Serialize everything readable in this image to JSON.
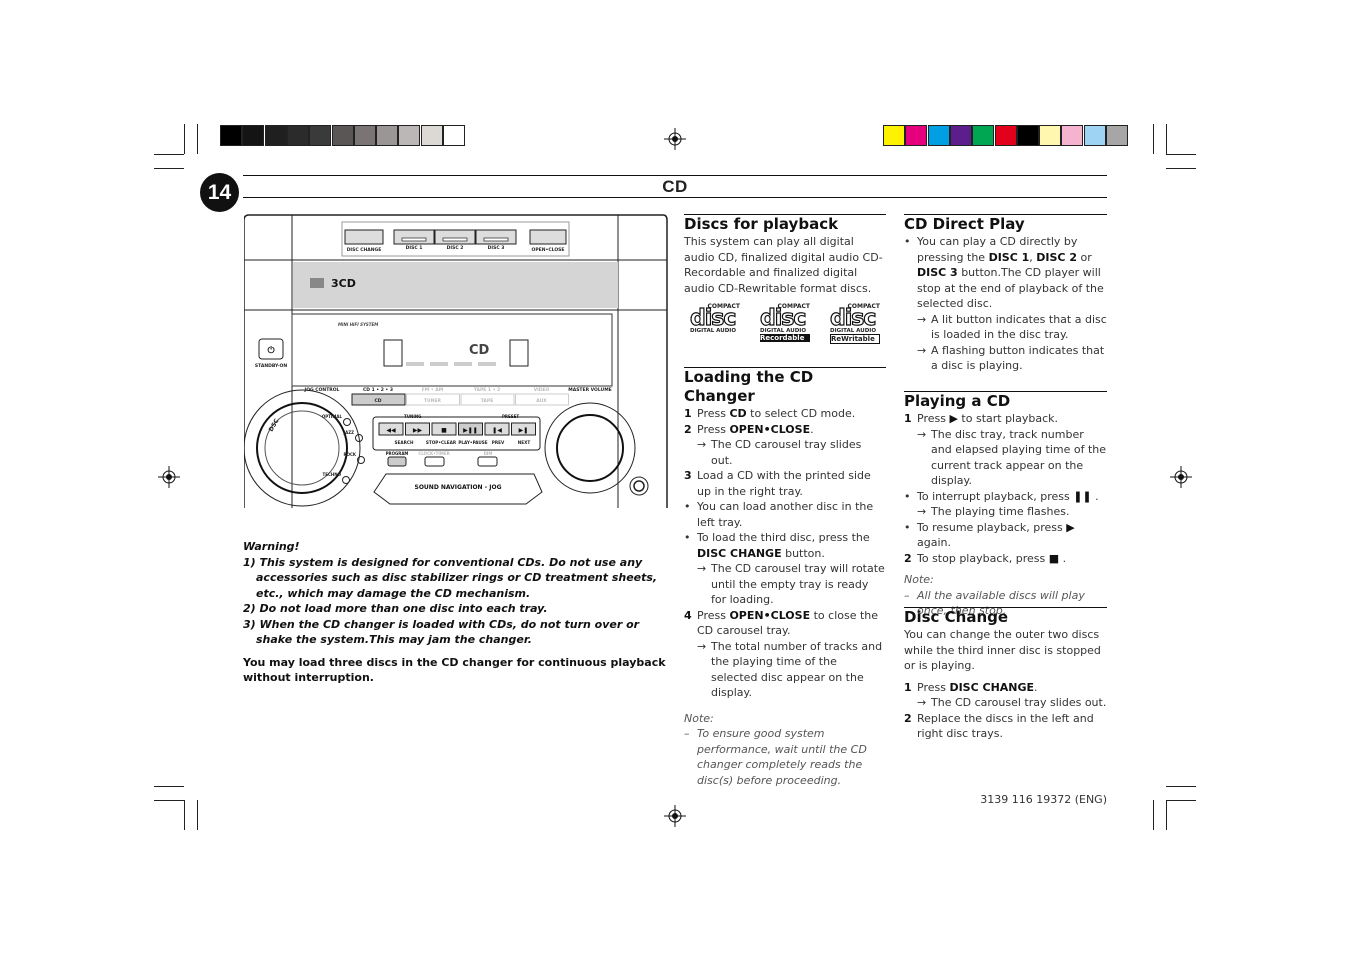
{
  "page_number": "14",
  "title": "CD",
  "colors": {
    "grayscale_bar": [
      "#000000",
      "#141414",
      "#1f1f1f",
      "#2b2b2b",
      "#3a3a3a",
      "#5a5656",
      "#7a7474",
      "#9a9696",
      "#bbb7b7",
      "#dcd8d4",
      "#ffffff"
    ],
    "color_bar": [
      "#fff200",
      "#e6007e",
      "#009fe3",
      "#5b1e8b",
      "#00a651",
      "#e2001a",
      "#000000",
      "#fff7b0",
      "#f6b3cf",
      "#9fd3f3",
      "#a6a6a6"
    ]
  },
  "device": {
    "disc_change": "DISC CHANGE",
    "disc1": "DISC 1",
    "disc2": "DISC 2",
    "disc3": "DISC 3",
    "open_close": "OPEN•CLOSE",
    "brand": "3CD",
    "model": "MINI HIFI SYSTEM",
    "display": "CD",
    "standby": "STANDBY-ON",
    "jog_control": "JOG CONTROL",
    "master_volume": "MASTER VOLUME",
    "sources": [
      {
        "top": "CD 1 • 2 • 3",
        "label": "CD"
      },
      {
        "top": "FM • AM",
        "label": "TUNER"
      },
      {
        "top": "TAPE 1 • 2",
        "label": "TAPE"
      },
      {
        "top": "VIDEO",
        "label": "AUX"
      }
    ],
    "sound": [
      "OPTIMAL",
      "JAZZ",
      "ROCK",
      "TECHNO"
    ],
    "dsc": "DSC",
    "tuning": "TUNING",
    "preset": "PRESET",
    "transport_labels": [
      "SEARCH",
      "STOP•CLEAR",
      "PLAY•PAUSE",
      "PREV",
      "NEXT"
    ],
    "program": "PROGRAM",
    "clock_timer": "CLOCK•TIMER",
    "dim": "DIM",
    "sound_nav": "SOUND NAVIGATION - JOG"
  },
  "warning": {
    "heading": "Warning!",
    "items": [
      "1) This system is designed for conventional CDs. Do not use any accessories such as disc stabilizer rings or CD treatment sheets, etc., which may damage the CD mechanism.",
      "2) Do not load more than one disc into each tray.",
      "3) When the CD changer is loaded with CDs, do not turn over or shake the system.This may jam the changer."
    ],
    "summary": "You may load three discs in the CD changer for continuous playback without interruption."
  },
  "discs_for_playback": {
    "heading": "Discs for playback",
    "text": "This system can play all digital audio CD, finalized digital audio CD-Recordable and finalized digital audio CD-Rewritable format discs.",
    "logos": [
      {
        "top": "COMPACT",
        "main": "disc",
        "sub": "DIGITAL AUDIO",
        "sub2": ""
      },
      {
        "top": "COMPACT",
        "main": "disc",
        "sub": "DIGITAL AUDIO",
        "sub2": "Recordable"
      },
      {
        "top": "COMPACT",
        "main": "disc",
        "sub": "DIGITAL AUDIO",
        "sub2": "ReWritable"
      }
    ]
  },
  "loading": {
    "heading": "Loading the CD Changer",
    "items": [
      {
        "type": "num",
        "mk": "1",
        "s": [
          [
            "Press "
          ],
          [
            "CD",
            1
          ],
          [
            " to select CD mode."
          ]
        ]
      },
      {
        "type": "num",
        "mk": "2",
        "s": [
          [
            "Press "
          ],
          [
            "OPEN•CLOSE",
            1
          ],
          [
            "."
          ]
        ]
      },
      {
        "type": "arrow",
        "mk": "→",
        "s": [
          [
            "The CD carousel tray slides out."
          ]
        ]
      },
      {
        "type": "num",
        "mk": "3",
        "s": [
          [
            "Load a CD with the printed side up in the right tray."
          ]
        ]
      },
      {
        "type": "bullet",
        "mk": "•",
        "s": [
          [
            "You can load another disc in the left tray."
          ]
        ]
      },
      {
        "type": "bullet",
        "mk": "•",
        "s": [
          [
            "To load the third disc, press the "
          ],
          [
            "DISC CHANGE",
            1
          ],
          [
            " button."
          ]
        ]
      },
      {
        "type": "arrow",
        "mk": "→",
        "s": [
          [
            "The CD carousel tray will rotate until the empty tray is ready for loading."
          ]
        ]
      },
      {
        "type": "num",
        "mk": "4",
        "s": [
          [
            "Press "
          ],
          [
            "OPEN•CLOSE",
            1
          ],
          [
            " to close the CD carousel tray."
          ]
        ]
      },
      {
        "type": "arrow",
        "mk": "→",
        "s": [
          [
            "The total number of tracks and the playing time of the selected disc appear on the display."
          ]
        ]
      }
    ],
    "note_label": "Note:",
    "note": [
      {
        "type": "dash",
        "mk": "–",
        "s": [
          [
            "To ensure good system performance, wait until the CD changer completely reads the disc(s) before proceeding."
          ]
        ]
      }
    ]
  },
  "direct_play": {
    "heading": "CD Direct Play",
    "items": [
      {
        "type": "bullet",
        "mk": "•",
        "s": [
          [
            "You can play a CD directly by pressing the "
          ],
          [
            "DISC 1",
            1
          ],
          [
            ", "
          ],
          [
            "DISC 2",
            1
          ],
          [
            " or "
          ],
          [
            "DISC 3",
            1
          ],
          [
            " button.The CD player will stop at the end of playback of the selected disc."
          ]
        ]
      },
      {
        "type": "arrow",
        "mk": "→",
        "s": [
          [
            "A lit button indicates that a disc is loaded in the disc tray."
          ]
        ]
      },
      {
        "type": "arrow",
        "mk": "→",
        "s": [
          [
            "A flashing button indicates that a disc is playing."
          ]
        ]
      }
    ]
  },
  "playing": {
    "heading": "Playing a CD",
    "items": [
      {
        "type": "num",
        "mk": "1",
        "s": [
          [
            "Press "
          ],
          [
            "▶",
            1
          ],
          [
            "  to start playback."
          ]
        ]
      },
      {
        "type": "arrow",
        "mk": "→",
        "s": [
          [
            "The disc tray, track number and elapsed playing time of the current track appear on the display."
          ]
        ]
      },
      {
        "type": "bullet",
        "mk": "•",
        "s": [
          [
            "To interrupt playback, press "
          ],
          [
            "❚❚",
            1
          ],
          [
            " ."
          ]
        ]
      },
      {
        "type": "arrow",
        "mk": "→",
        "s": [
          [
            "The playing time flashes."
          ]
        ]
      },
      {
        "type": "bullet",
        "mk": "•",
        "s": [
          [
            "To resume playback, press "
          ],
          [
            "▶",
            1
          ],
          [
            "  again."
          ]
        ]
      },
      {
        "type": "num",
        "mk": "2",
        "s": [
          [
            "To stop playback, press  "
          ],
          [
            "■",
            1
          ],
          [
            " ."
          ]
        ]
      }
    ],
    "note_label": "Note:",
    "note": [
      {
        "type": "dash",
        "mk": "–",
        "s": [
          [
            "All the available discs will play once, then stop."
          ]
        ]
      }
    ]
  },
  "disc_change": {
    "heading": "Disc Change",
    "text": "You can change the outer two discs while the third inner disc is stopped or is playing.",
    "items": [
      {
        "type": "num",
        "mk": "1",
        "s": [
          [
            "Press "
          ],
          [
            "DISC CHANGE",
            1
          ],
          [
            "."
          ]
        ]
      },
      {
        "type": "arrow",
        "mk": "→",
        "s": [
          [
            "The CD carousel tray slides out."
          ]
        ]
      },
      {
        "type": "num",
        "mk": "2",
        "s": [
          [
            "Replace the discs in the left and right disc trays."
          ]
        ]
      }
    ]
  },
  "footer": "3139 116 19372 (ENG)"
}
